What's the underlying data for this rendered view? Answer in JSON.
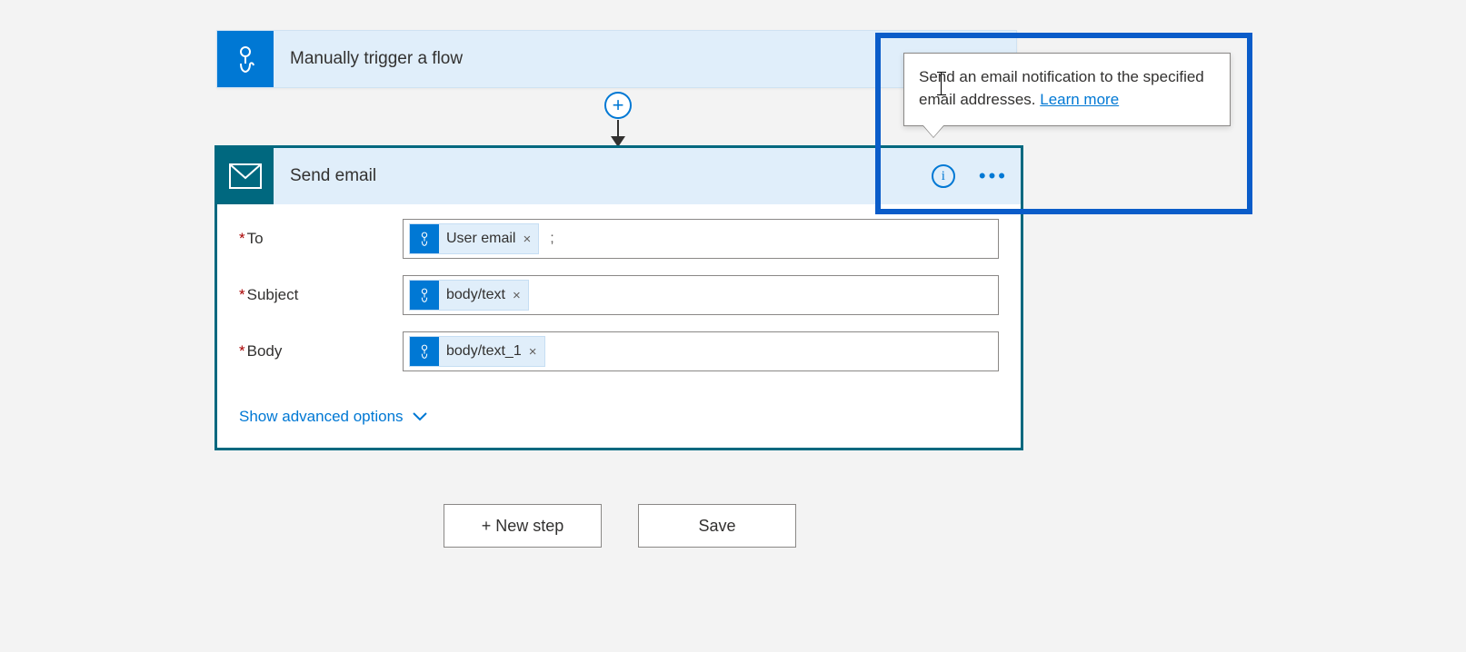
{
  "trigger": {
    "title": "Manually trigger a flow"
  },
  "action": {
    "title": "Send email",
    "fields": {
      "to": {
        "label": "To",
        "token": "User email",
        "trailing": ";"
      },
      "subject": {
        "label": "Subject",
        "token": "body/text"
      },
      "body": {
        "label": "Body",
        "token": "body/text_1"
      }
    },
    "show_advanced": "Show advanced options"
  },
  "tooltip": {
    "text": "Send an email notification to the specified email addresses. ",
    "link": "Learn more"
  },
  "footer": {
    "new_step": "+ New step",
    "save": "Save"
  }
}
